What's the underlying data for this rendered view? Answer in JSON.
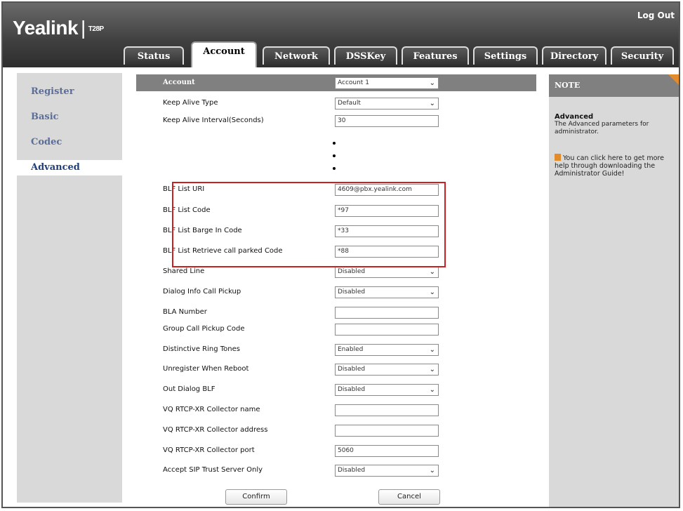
{
  "header": {
    "brand": "Yealink",
    "model": "T28P",
    "logout": "Log Out"
  },
  "tabs": [
    "Status",
    "Account",
    "Network",
    "DSSKey",
    "Features",
    "Settings",
    "Directory",
    "Security"
  ],
  "active_tab": "Account",
  "sidebar": {
    "items": [
      "Register",
      "Basic",
      "Codec",
      "Advanced"
    ],
    "active": "Advanced"
  },
  "form": {
    "account_label": "Account",
    "account_value": "Account 1",
    "rows": [
      {
        "label": "Keep Alive Type",
        "value": "Default",
        "type": "select"
      },
      {
        "label": "Keep Alive Interval(Seconds)",
        "value": "30",
        "type": "input"
      },
      {
        "label": "BLF List URI",
        "value": "4609@pbx.yealink.com",
        "type": "input"
      },
      {
        "label": "BLF List Code",
        "value": "*97",
        "type": "input"
      },
      {
        "label": "BLF List Barge In Code",
        "value": "*33",
        "type": "input"
      },
      {
        "label": "BLF List Retrieve call parked Code",
        "value": "*88",
        "type": "input"
      },
      {
        "label": "Shared Line",
        "value": "Disabled",
        "type": "select"
      },
      {
        "label": "Dialog Info Call Pickup",
        "value": "Disabled",
        "type": "select"
      },
      {
        "label": "BLA Number",
        "value": "",
        "type": "input"
      },
      {
        "label": "Group Call Pickup Code",
        "value": "",
        "type": "input"
      },
      {
        "label": "Distinctive Ring Tones",
        "value": "Enabled",
        "type": "select"
      },
      {
        "label": "Unregister When Reboot",
        "value": "Disabled",
        "type": "select"
      },
      {
        "label": "Out Dialog BLF",
        "value": "Disabled",
        "type": "select"
      },
      {
        "label": "VQ RTCP-XR Collector name",
        "value": "",
        "type": "input"
      },
      {
        "label": "VQ RTCP-XR Collector address",
        "value": "",
        "type": "input"
      },
      {
        "label": "VQ RTCP-XR Collector port",
        "value": "5060",
        "type": "input"
      },
      {
        "label": "Accept SIP Trust Server Only",
        "value": "Disabled",
        "type": "select"
      }
    ],
    "confirm": "Confirm",
    "cancel": "Cancel"
  },
  "note": {
    "title": "NOTE",
    "heading": "Advanced",
    "description": "The Advanced parameters for administrator.",
    "help": "You can click here to get more help through downloading the Administrator Guide!"
  },
  "colors": {
    "highlight": "#cc1f1f",
    "accent": "#e38a2a",
    "sidebar_text": "#5b6e9a"
  },
  "icons": [
    "chevron-down-icon",
    "guide-book-icon"
  ]
}
